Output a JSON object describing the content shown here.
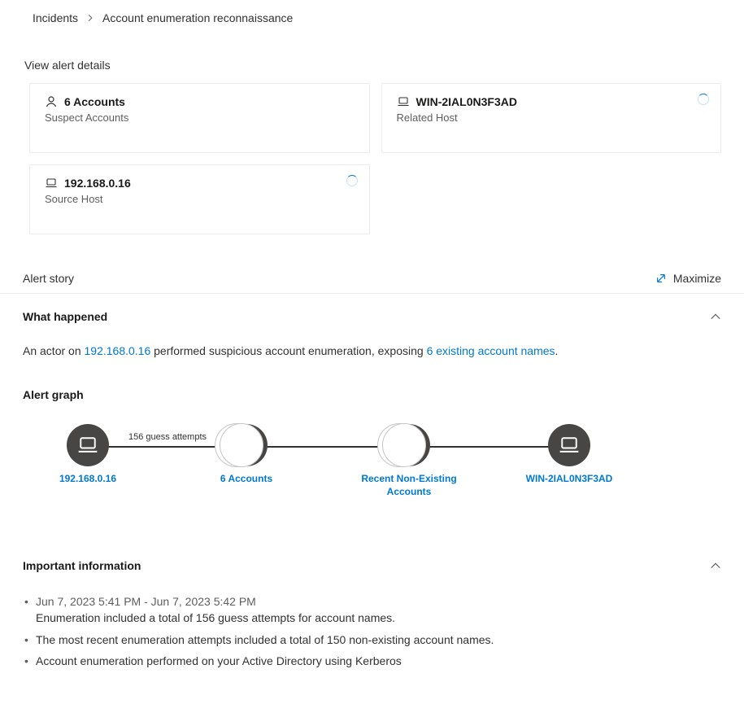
{
  "breadcrumb": {
    "parent": "Incidents",
    "current": "Account enumeration reconnaissance"
  },
  "sections": {
    "view_alert_details": "View alert details",
    "alert_story": "Alert story",
    "maximize_label": "Maximize",
    "what_happened": "What happened",
    "alert_graph": "Alert graph",
    "important_info": "Important information"
  },
  "cards": {
    "accounts": {
      "title": "6 Accounts",
      "subtitle": "Suspect Accounts"
    },
    "related_host": {
      "title": "WIN-2IAL0N3F3AD",
      "subtitle": "Related Host"
    },
    "source_host": {
      "title": "192.168.0.16",
      "subtitle": "Source Host"
    }
  },
  "what_happened": {
    "prefix": "An actor on ",
    "ip_link": "192.168.0.16",
    "middle": " performed suspicious account enumeration, exposing ",
    "accounts_link": "6 existing account names",
    "suffix": "."
  },
  "graph": {
    "edge1_label": "156 guess attempts",
    "nodes": {
      "source": "192.168.0.16",
      "accounts": "6 Accounts",
      "nonexisting": "Recent Non-Existing Accounts",
      "target": "WIN-2IAL0N3F3AD"
    }
  },
  "important": {
    "time_range": "Jun 7, 2023 5:41 PM - Jun 7, 2023 5:42 PM",
    "line1b": "Enumeration included a total of 156 guess attempts for account names.",
    "line2": "The most recent enumeration attempts included a total of 150 non-existing account names.",
    "line3": "Account enumeration performed on your Active Directory using Kerberos"
  }
}
